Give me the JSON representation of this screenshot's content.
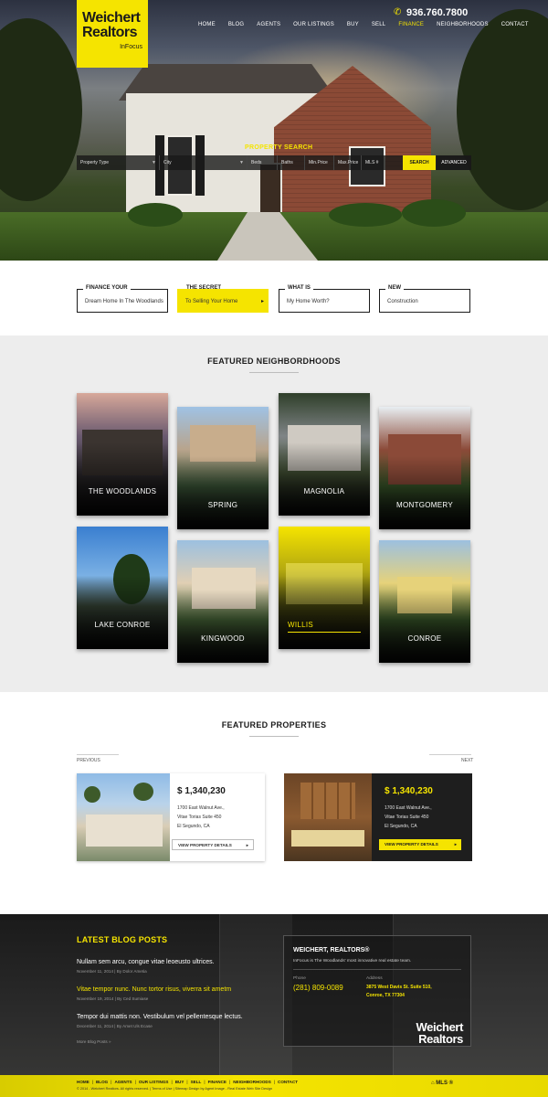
{
  "brand": {
    "logo_line1": "Weichert",
    "logo_line2": "Realtors",
    "logo_sub": "InFocus",
    "phone": "936.760.7800",
    "accent": "#f5e400"
  },
  "nav": {
    "items": [
      "HOME",
      "BLOG",
      "AGENTS",
      "OUR LISTINGS",
      "BUY",
      "SELL",
      "FINANCE",
      "NEIGHBORHOODS",
      "CONTACT"
    ],
    "active": "FINANCE"
  },
  "search": {
    "title": "PROPERTY SEARCH",
    "fields": [
      "Property Type",
      "City",
      "Beds",
      "Baths",
      "Min.Price",
      "Max.Price",
      "MLS #"
    ],
    "search_label": "SEARCH",
    "advanced_label": "ADVANCED"
  },
  "callouts": [
    {
      "title": "FINANCE YOUR",
      "subtitle": "Dream Home In The Woodlands"
    },
    {
      "title": "THE SECRET",
      "subtitle": "To Selling Your Home"
    },
    {
      "title": "WHAT IS",
      "subtitle": "My Home Worth?"
    },
    {
      "title": "NEW",
      "subtitle": "Construction"
    }
  ],
  "neighborhoods": {
    "title": "FEATURED NEIGHBORDHOODS",
    "items": [
      "THE WOODLANDS",
      "SPRING",
      "MAGNOLIA",
      "MONTGOMERY",
      "LAKE CONROE",
      "KINGWOOD",
      "WILLIS",
      "CONROE"
    ]
  },
  "properties": {
    "title": "FEATURED PROPERTIES",
    "prev": "PREVIOUS",
    "next": "NEXT",
    "items": [
      {
        "price": "$ 1,340,230",
        "addr1": "1700 East Walnut Ave.,",
        "addr2": "Vitae Torias Suite 450",
        "addr3": "El Segundo, CA",
        "button": "VIEW PROPERTY DETAILS"
      },
      {
        "price": "$ 1,340,230",
        "addr1": "1700 East Walnut Ave.,",
        "addr2": "Vitae Torias Suite 450",
        "addr3": "El Segundo, CA",
        "button": "VIEW PROPERTY DETAILS"
      }
    ]
  },
  "footer": {
    "blog_title": "LATEST BLOG POSTS",
    "posts": [
      {
        "title": "Nullam sem arcu, congue vitae leoeusto ultrices.",
        "meta": "November 11, 2014  |  By Dolor Ametia"
      },
      {
        "title": "Vitae tempor nunc. Nunc tortor risus, viverra sit ametm",
        "meta": "November 19, 2014  |  By Ced Sumiase"
      },
      {
        "title": "Tempor dui mattis non. Vestibulum vel pellentesque lectus.",
        "meta": "December 11, 2014  |  By Amet Uls Ecase"
      }
    ],
    "more_posts": "More Blog Posts »",
    "company": "WEICHERT, REALTORS®",
    "company_desc": "InFocus is The Woodlands' most innovative real estate team.",
    "phone_label": "Phone",
    "phone": "(281) 809-0089",
    "address_label": "Address",
    "address1": "3875 West Davis St. Suite 510,",
    "address2": "Conroe, TX 77304",
    "logo_line1": "Weichert",
    "logo_line2": "Realtors",
    "bottom_nav": [
      "HOME",
      "BLOG",
      "AGENTS",
      "OUR LISTINGS",
      "BUY",
      "SELL",
      "FINANCE",
      "NEIGHBORHOODS",
      "CONTACT"
    ],
    "copyright": "© 2014 - Weichert Realtors. All rights reserved. | Terms of Use | Sitemap Design by Agent Image - Real Estate Web Site Design",
    "mls_label": "MLS"
  }
}
